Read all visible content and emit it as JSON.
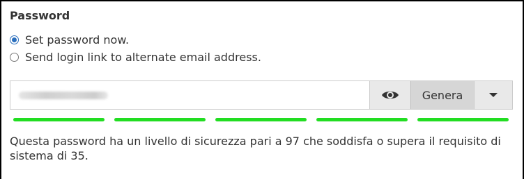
{
  "section": {
    "title": "Password"
  },
  "options": [
    {
      "label": "Set password now.",
      "checked": true
    },
    {
      "label": "Send login link to alternate email address.",
      "checked": false
    }
  ],
  "password_field": {
    "masked": true
  },
  "buttons": {
    "toggle_visibility_icon": "eye-icon",
    "generate_label": "Genera",
    "dropdown_icon": "caret-down-icon"
  },
  "strength": {
    "segments_filled": 5,
    "segments_total": 5,
    "color": "#22dd22"
  },
  "message": "Questa password ha un livello di sicurezza pari a 97 che soddisfa o supera il requisito di sistema di 35."
}
